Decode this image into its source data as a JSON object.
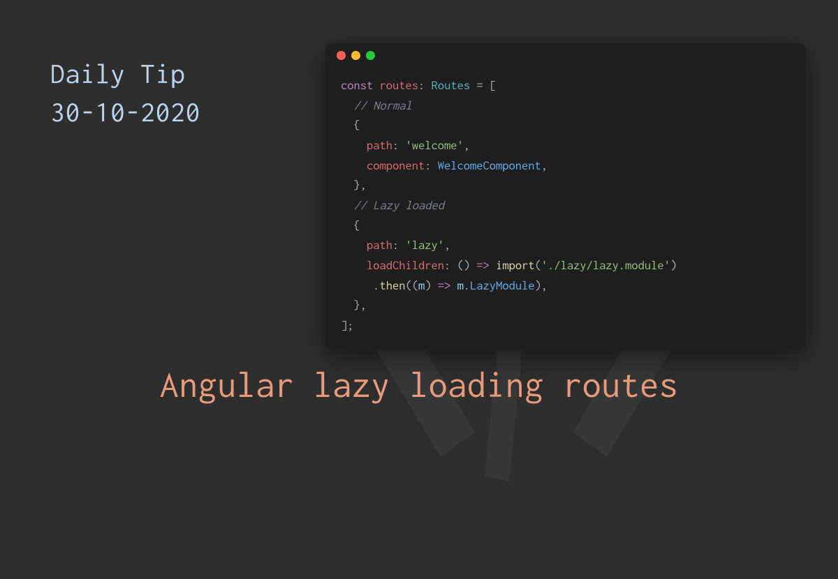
{
  "header": {
    "line1": "Daily Tip",
    "line2": "30-10-2020"
  },
  "main_title": "Angular lazy loading routes",
  "code": {
    "tokens": [
      [
        {
          "c": "kw",
          "t": "const"
        },
        {
          "c": "punc",
          "t": " "
        },
        {
          "c": "var",
          "t": "routes"
        },
        {
          "c": "punc",
          "t": ": "
        },
        {
          "c": "type",
          "t": "Routes"
        },
        {
          "c": "punc",
          "t": " = ["
        }
      ],
      [
        {
          "c": "punc",
          "t": "  "
        },
        {
          "c": "comment",
          "t": "// Normal"
        }
      ],
      [
        {
          "c": "punc",
          "t": "  {"
        }
      ],
      [
        {
          "c": "punc",
          "t": "    "
        },
        {
          "c": "prop",
          "t": "path"
        },
        {
          "c": "punc",
          "t": ": "
        },
        {
          "c": "str",
          "t": "'welcome'"
        },
        {
          "c": "punc",
          "t": ","
        }
      ],
      [
        {
          "c": "punc",
          "t": "    "
        },
        {
          "c": "prop",
          "t": "component"
        },
        {
          "c": "punc",
          "t": ": "
        },
        {
          "c": "class",
          "t": "WelcomeComponent"
        },
        {
          "c": "punc",
          "t": ","
        }
      ],
      [
        {
          "c": "punc",
          "t": "  },"
        }
      ],
      [
        {
          "c": "punc",
          "t": "  "
        },
        {
          "c": "comment",
          "t": "// Lazy loaded"
        }
      ],
      [
        {
          "c": "punc",
          "t": "  {"
        }
      ],
      [
        {
          "c": "punc",
          "t": "    "
        },
        {
          "c": "prop",
          "t": "path"
        },
        {
          "c": "punc",
          "t": ": "
        },
        {
          "c": "str",
          "t": "'lazy'"
        },
        {
          "c": "punc",
          "t": ","
        }
      ],
      [
        {
          "c": "punc",
          "t": "    "
        },
        {
          "c": "prop",
          "t": "loadChildren"
        },
        {
          "c": "punc",
          "t": ": () "
        },
        {
          "c": "kw",
          "t": "=>"
        },
        {
          "c": "punc",
          "t": " "
        },
        {
          "c": "fn",
          "t": "import"
        },
        {
          "c": "punc",
          "t": "("
        },
        {
          "c": "str",
          "t": "'./lazy/lazy.module'"
        },
        {
          "c": "punc",
          "t": ")"
        }
      ],
      [
        {
          "c": "punc",
          "t": "     ."
        },
        {
          "c": "fn",
          "t": "then"
        },
        {
          "c": "punc",
          "t": "(("
        },
        {
          "c": "param",
          "t": "m"
        },
        {
          "c": "punc",
          "t": ") "
        },
        {
          "c": "kw",
          "t": "=>"
        },
        {
          "c": "punc",
          "t": " "
        },
        {
          "c": "param",
          "t": "m"
        },
        {
          "c": "punc",
          "t": "."
        },
        {
          "c": "class",
          "t": "LazyModule"
        },
        {
          "c": "punc",
          "t": "),"
        }
      ],
      [
        {
          "c": "punc",
          "t": "  },"
        }
      ],
      [
        {
          "c": "punc",
          "t": "];"
        }
      ]
    ]
  }
}
